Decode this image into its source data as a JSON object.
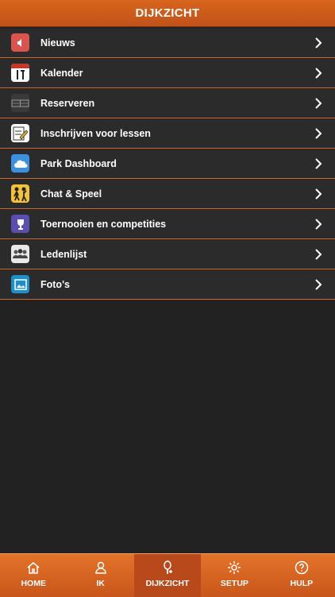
{
  "header": {
    "title": "DIJKZICHT"
  },
  "menu": {
    "items": [
      {
        "label": "Nieuws",
        "icon": "speaker-icon",
        "color": "#d9534f"
      },
      {
        "label": "Kalender",
        "icon": "calendar-icon",
        "color": "#ffffff"
      },
      {
        "label": "Reserveren",
        "icon": "court-grid-icon",
        "color": "#3a3a3a"
      },
      {
        "label": "Inschrijven voor lessen",
        "icon": "pen-paper-icon",
        "color": "#ffffff"
      },
      {
        "label": "Park Dashboard",
        "icon": "cloud-icon",
        "color": "#3d8fe0"
      },
      {
        "label": "Chat & Speel",
        "icon": "players-icon",
        "color": "#f3c23a"
      },
      {
        "label": "Toernooien en competities",
        "icon": "trophy-icon",
        "color": "#5a4fb0"
      },
      {
        "label": "Ledenlijst",
        "icon": "members-icon",
        "color": "#e8e8e8"
      },
      {
        "label": "Foto's",
        "icon": "photo-icon",
        "color": "#1e8fc8"
      }
    ]
  },
  "tabbar": {
    "tabs": [
      {
        "label": "HOME",
        "icon": "home-icon",
        "active": false
      },
      {
        "label": "IK",
        "icon": "user-icon",
        "active": false
      },
      {
        "label": "DIJKZICHT",
        "icon": "racket-icon",
        "active": true
      },
      {
        "label": "SETUP",
        "icon": "gear-icon",
        "active": false
      },
      {
        "label": "HULP",
        "icon": "help-icon",
        "active": false
      }
    ]
  },
  "colors": {
    "accent": "#d06a2b",
    "background": "#222222",
    "row": "#2b2b2b"
  }
}
